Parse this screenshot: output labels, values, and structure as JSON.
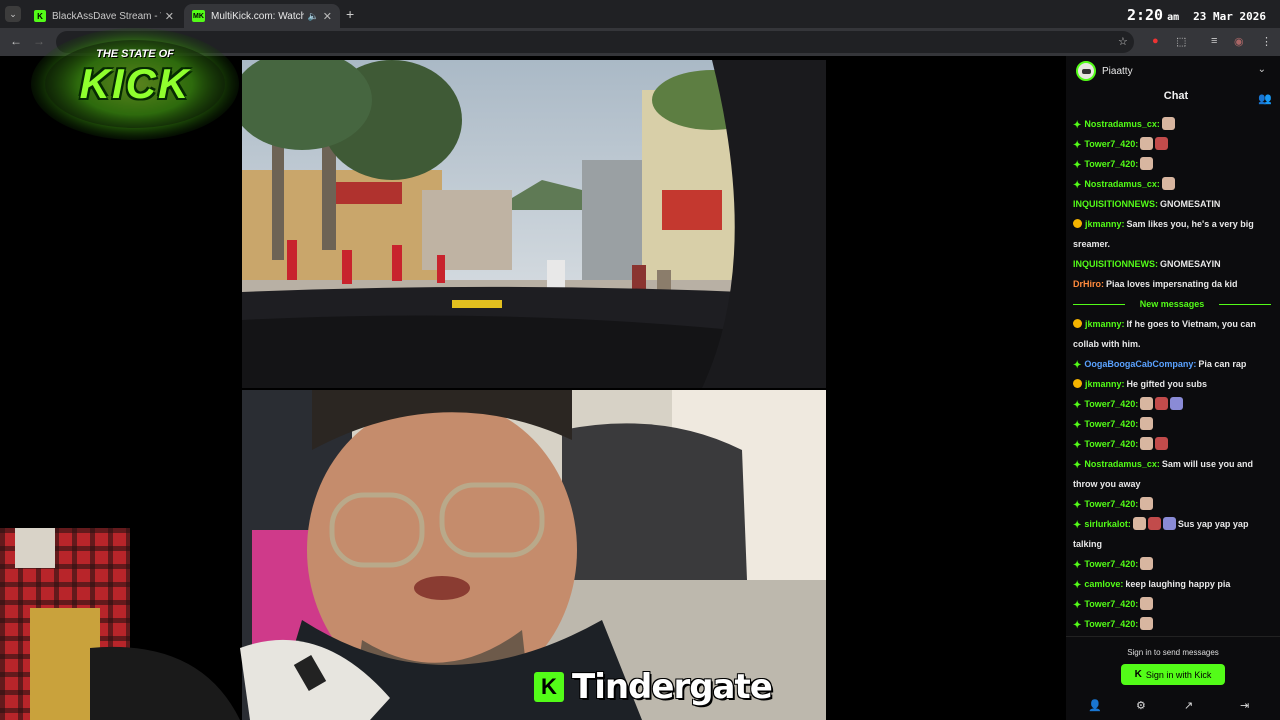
{
  "browser": {
    "tabs": [
      {
        "label": "BlackAssDave Stream - Watch L"
      },
      {
        "label": "MultiKick.com: Watch Multi"
      }
    ],
    "new_tab_label": "+"
  },
  "clock": {
    "time": "2:20",
    "ampm": "am",
    "date": "23 Mar 2026"
  },
  "logo": {
    "line1": "THE STATE OF",
    "line2": "KICK"
  },
  "caption": {
    "text": "Tindergate"
  },
  "chat": {
    "channel_name": "Piaatty",
    "title": "Chat",
    "messages": [
      {
        "badge": "sub",
        "user": "Nostradamus_cx:",
        "user_color": "#53fc18",
        "text": "",
        "emotes": 1
      },
      {
        "badge": "sub",
        "user": "Tower7_420:",
        "user_color": "#53fc18",
        "text": "",
        "emotes": 2
      },
      {
        "badge": "sub",
        "user": "Tower7_420:",
        "user_color": "#53fc18",
        "text": "",
        "emotes": 1
      },
      {
        "badge": "sub",
        "user": "Nostradamus_cx:",
        "user_color": "#53fc18",
        "text": "",
        "emotes": 1
      },
      {
        "badge": "",
        "user": "INQUISITIONNEWS:",
        "user_color": "#53fc18",
        "text": "GNOMESATIN",
        "emotes": 0
      },
      {
        "badge": "coin",
        "user": "jkmanny:",
        "user_color": "#53fc18",
        "text": "Sam likes you, he's a very big sreamer.",
        "emotes": 0
      },
      {
        "badge": "",
        "user": "INQUISITIONNEWS:",
        "user_color": "#53fc18",
        "text": "GNOMESAYIN",
        "emotes": 0
      },
      {
        "badge": "",
        "user": "DrHiro:",
        "user_color": "#ff8a3d",
        "text": "Piaa loves impersnating da kid",
        "emotes": 0
      }
    ],
    "new_messages_label": "New messages",
    "new_messages": [
      {
        "badge": "coin",
        "user": "jkmanny:",
        "user_color": "#53fc18",
        "text": "If he goes to Vietnam, you can collab with him.",
        "emotes": 0
      },
      {
        "badge": "sub",
        "user": "OogaBoogaCabCompany:",
        "user_color": "#5aa2ff",
        "text": "Pia can rap",
        "emotes": 0
      },
      {
        "badge": "coin",
        "user": "jkmanny:",
        "user_color": "#53fc18",
        "text": "He gifted you subs",
        "emotes": 0
      },
      {
        "badge": "sub",
        "user": "Tower7_420:",
        "user_color": "#53fc18",
        "text": "",
        "emotes": 3
      },
      {
        "badge": "sub",
        "user": "Tower7_420:",
        "user_color": "#53fc18",
        "text": "",
        "emotes": 1
      },
      {
        "badge": "sub",
        "user": "Tower7_420:",
        "user_color": "#53fc18",
        "text": "",
        "emotes": 2
      },
      {
        "badge": "sub",
        "user": "Nostradamus_cx:",
        "user_color": "#53fc18",
        "text": "Sam will use you and throw you away",
        "emotes": 0
      },
      {
        "badge": "sub",
        "user": "Tower7_420:",
        "user_color": "#53fc18",
        "text": "",
        "emotes": 1
      },
      {
        "badge": "sub",
        "user": "sirlurkalot:",
        "user_color": "#53fc18",
        "text": "Sus yap yap yap talking",
        "emotes": 3
      },
      {
        "badge": "sub",
        "user": "Tower7_420:",
        "user_color": "#53fc18",
        "text": "",
        "emotes": 1
      },
      {
        "badge": "sub",
        "user": "camlove:",
        "user_color": "#53fc18",
        "text": "keep laughing happy pia",
        "emotes": 0
      },
      {
        "badge": "sub",
        "user": "Tower7_420:",
        "user_color": "#53fc18",
        "text": "",
        "emotes": 1
      },
      {
        "badge": "sub",
        "user": "Tower7_420:",
        "user_color": "#53fc18",
        "text": "",
        "emotes": 1
      }
    ],
    "signin_prompt": "Sign in to send messages",
    "signin_button": "Sign in with Kick"
  },
  "colors": {
    "kick_green": "#53fc18",
    "chat_bg": "#0c0c0e",
    "browser_dark": "#202124"
  },
  "icons": [
    "tab-search-icon",
    "back-arrow-icon",
    "forward-arrow-icon",
    "bookmark-star-icon",
    "extensions-icon",
    "media-icon",
    "profile-icon",
    "menu-dots-icon",
    "users-icon",
    "follow-icon",
    "settings-icon",
    "popout-icon",
    "exit-icon"
  ]
}
